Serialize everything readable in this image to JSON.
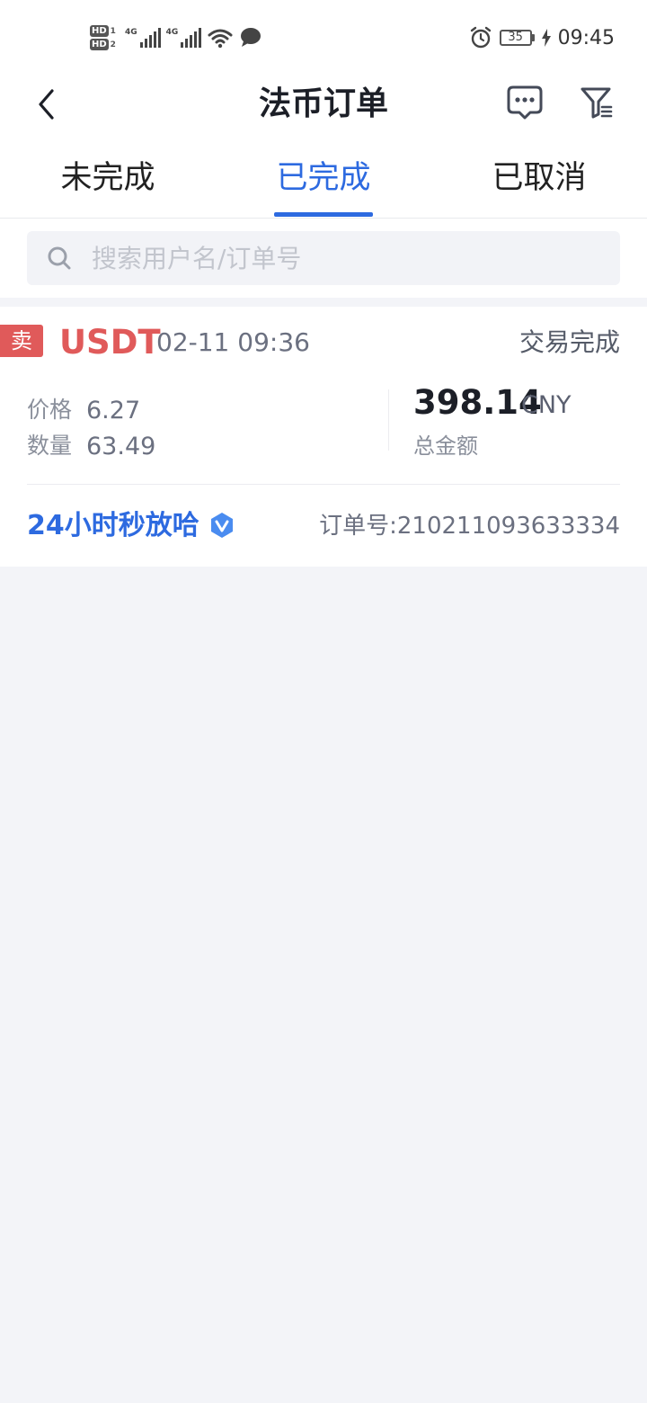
{
  "status_bar": {
    "hd1": "HD",
    "hd1_num": "1",
    "hd2": "HD",
    "hd2_num": "2",
    "net1": "4G",
    "net2": "4G",
    "battery": "35",
    "time": "09:45"
  },
  "header": {
    "title": "法币订单"
  },
  "tabs": [
    {
      "label": "未完成",
      "active": false
    },
    {
      "label": "已完成",
      "active": true
    },
    {
      "label": "已取消",
      "active": false
    }
  ],
  "search": {
    "placeholder": "搜索用户名/订单号",
    "value": ""
  },
  "order": {
    "side": "卖",
    "coin": "USDT",
    "time": "02-11 09:36",
    "status": "交易完成",
    "price_label": "价格",
    "price": "6.27",
    "quantity_label": "数量",
    "quantity": "63.49",
    "total": "398.14",
    "currency": "CNY",
    "total_label": "总金额",
    "merchant": "24小时秒放哈",
    "order_no": "订单号:210211093633334"
  },
  "colors": {
    "accent": "#2d6ae0",
    "sell": "#e05a5a",
    "background": "#f3f4f8"
  }
}
